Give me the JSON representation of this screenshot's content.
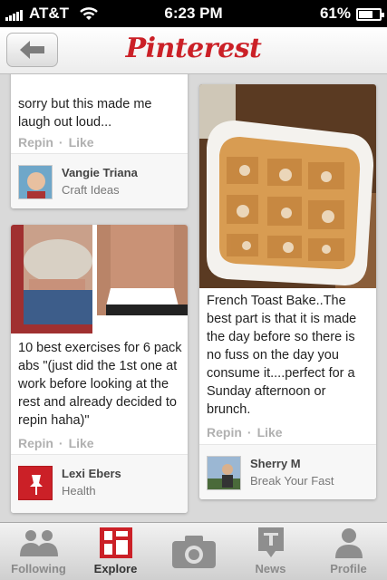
{
  "status_bar": {
    "carrier": "AT&T",
    "time": "6:23 PM",
    "battery": "61%",
    "battery_level": 0.61
  },
  "header": {
    "back_icon": "back-arrow-icon",
    "logo": "Pinterest",
    "brand_color": "#cb2027"
  },
  "pins": [
    {
      "description": "sorry but this made me laugh out loud...",
      "repin_label": "Repin",
      "like_label": "Like",
      "separator": "·",
      "user": "Vangie Triana",
      "board": "Craft Ideas"
    },
    {
      "description": "10 best exercises for 6 pack abs \"(just did the 1st one at work before looking at the rest and already decided to repin haha)\"",
      "repin_label": "Repin",
      "like_label": "Like",
      "separator": "·",
      "user": "Lexi Ebers",
      "board": "Health"
    },
    {
      "description": "French Toast Bake..The best part is that it is made the day before so there is no fuss on the day you consume it....perfect for a Sunday afternoon or brunch.",
      "repin_label": "Repin",
      "like_label": "Like",
      "separator": "·",
      "user": "Sherry M",
      "board": "Break Your Fast"
    }
  ],
  "tabs": [
    {
      "label": "Following",
      "icon": "people-icon"
    },
    {
      "label": "Explore",
      "icon": "explore-grid-icon",
      "active": true
    },
    {
      "label": "",
      "icon": "camera-icon"
    },
    {
      "label": "News",
      "icon": "news-icon"
    },
    {
      "label": "Profile",
      "icon": "profile-icon"
    }
  ]
}
